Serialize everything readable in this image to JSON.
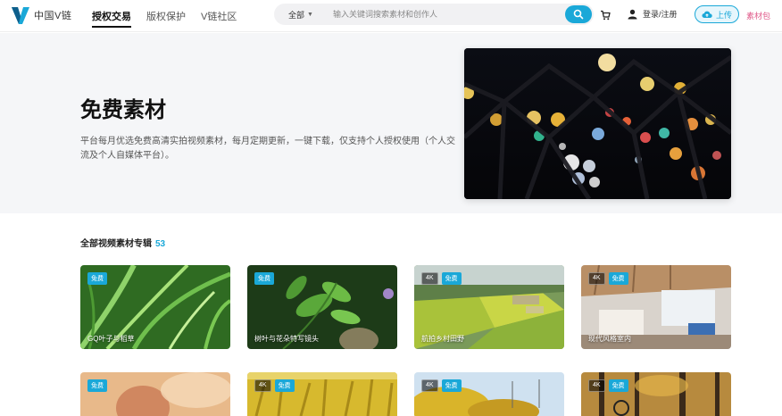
{
  "header": {
    "logo_text": "中国V链",
    "nav": [
      {
        "label": "授权交易",
        "active": true
      },
      {
        "label": "版权保护",
        "active": false
      },
      {
        "label": "V链社区",
        "active": false
      }
    ],
    "search": {
      "category": "全部",
      "placeholder": "输入关键词搜索素材和创作人"
    },
    "user_name": "登录/注册",
    "upload_label": "上传",
    "vip_label": "素材包"
  },
  "hero": {
    "title": "免费素材",
    "description": "平台每月优选免费高清实拍视频素材，每月定期更新，一键下载，仅支持个人授权使用（个人交流及个人自媒体平台）。"
  },
  "section": {
    "title": "全部视频素材专辑",
    "count": "53"
  },
  "cards": [
    {
      "free": "免费",
      "label": "GQ叶子与稻草"
    },
    {
      "free": "免费",
      "label": "树叶与花朵特写镜头"
    },
    {
      "res": "4K",
      "free": "免费",
      "label": "航拍乡村田野"
    },
    {
      "res": "4K",
      "free": "免费",
      "label": "现代风格室内"
    },
    {
      "free": "免费",
      "label": ""
    },
    {
      "res": "4K",
      "free": "免费",
      "label": ""
    },
    {
      "res": "4K",
      "free": "免费",
      "label": ""
    },
    {
      "res": "4K",
      "free": "免费",
      "label": ""
    }
  ],
  "colors": {
    "accent": "#1aa8d8",
    "vip": "#e05a8a"
  }
}
